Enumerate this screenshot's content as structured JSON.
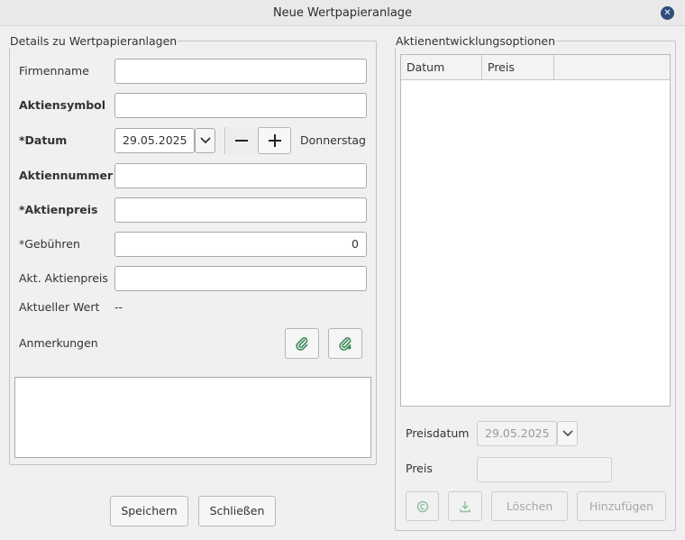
{
  "window": {
    "title": "Neue Wertpapieranlage",
    "close_icon": "close-icon"
  },
  "details": {
    "legend": "Details zu Wertpapieranlagen",
    "firmenname": {
      "label": "Firmenname",
      "value": ""
    },
    "aktiensymbol": {
      "label": "Aktiensymbol",
      "value": ""
    },
    "datum": {
      "label": "*Datum",
      "value": "29.05.2025",
      "weekday": "Donnerstag"
    },
    "aktiennummer": {
      "label": "Aktiennummer",
      "value": ""
    },
    "aktienpreis": {
      "label": "*Aktienpreis",
      "value": ""
    },
    "gebuehren": {
      "label": "*Gebühren",
      "value": "0"
    },
    "akt_aktienpreis": {
      "label": "Akt. Aktienpreis",
      "value": ""
    },
    "aktueller_wert": {
      "label": "Aktueller Wert",
      "value": "--"
    },
    "anmerkungen": {
      "label": "Anmerkungen",
      "value": ""
    }
  },
  "buttons": {
    "save": "Speichern",
    "close": "Schließen"
  },
  "options": {
    "legend": "Aktienentwicklungsoptionen",
    "columns": [
      "Datum",
      "Preis"
    ],
    "rows": [],
    "preisdatum": {
      "label": "Preisdatum",
      "value": "29.05.2025"
    },
    "preis": {
      "label": "Preis",
      "value": ""
    },
    "delete": "Löschen",
    "add": "Hinzufügen"
  },
  "colors": {
    "accent": "#2e4d7a",
    "attachment": "#3f8a5a"
  }
}
